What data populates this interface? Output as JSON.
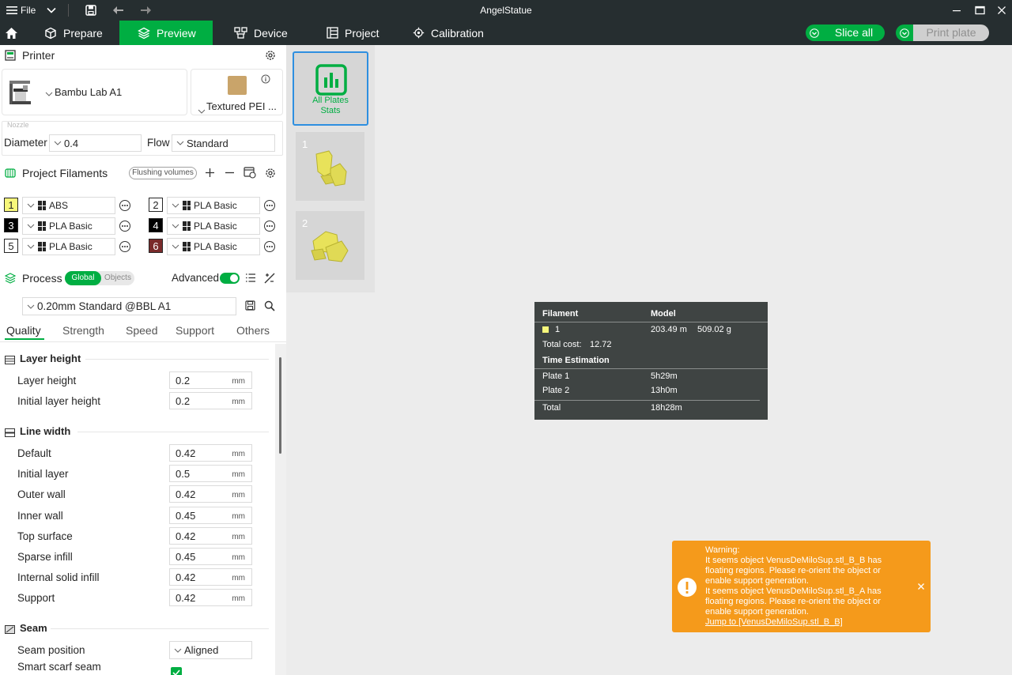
{
  "titlebar": {
    "menu_label": "File",
    "app_title": "AngelStatue"
  },
  "nav": {
    "tabs": [
      {
        "label": "Prepare",
        "icon": "cube-icon"
      },
      {
        "label": "Preview",
        "icon": "layers-icon",
        "active": true
      },
      {
        "label": "Device",
        "icon": "device-icon"
      },
      {
        "label": "Project",
        "icon": "project-icon"
      },
      {
        "label": "Calibration",
        "icon": "calibration-icon"
      }
    ],
    "slice_label": "Slice all",
    "print_label": "Print plate",
    "accent_color": "#00ae42"
  },
  "printer": {
    "section_title": "Printer",
    "printer_name": "Bambu Lab A1",
    "plate_type": "Textured PEI ...",
    "nozzle_label": "Nozzle",
    "diameter_label": "Diameter",
    "diameter_value": "0.4",
    "flow_label": "Flow",
    "flow_value": "Standard"
  },
  "filaments": {
    "section_title": "Project Filaments",
    "flushing_label": "Flushing volumes",
    "items": [
      {
        "num": "1",
        "name": "ABS",
        "color": "#f7f77b",
        "text_color": "#262626"
      },
      {
        "num": "2",
        "name": "PLA Basic",
        "color": "#ffffff",
        "text_color": "#262626"
      },
      {
        "num": "3",
        "name": "PLA Basic",
        "color": "#000000",
        "text_color": "#ffffff"
      },
      {
        "num": "4",
        "name": "PLA Basic",
        "color": "#000000",
        "text_color": "#ffffff"
      },
      {
        "num": "5",
        "name": "PLA Basic",
        "color": "#ffffff",
        "text_color": "#262626"
      },
      {
        "num": "6",
        "name": "PLA Basic",
        "color": "#7a2b2b",
        "text_color": "#ffffff"
      }
    ]
  },
  "process": {
    "section_title": "Process",
    "global_label": "Global",
    "objects_label": "Objects",
    "advanced_label": "Advanced",
    "advanced_on": true,
    "preset": "0.20mm Standard @BBL A1",
    "tabs": [
      "Quality",
      "Strength",
      "Speed",
      "Support",
      "Others"
    ],
    "active_tab": "Quality",
    "groups": {
      "layer_height": {
        "title": "Layer height",
        "rows": [
          {
            "label": "Layer height",
            "value": "0.2",
            "unit": "mm"
          },
          {
            "label": "Initial layer height",
            "value": "0.2",
            "unit": "mm"
          }
        ]
      },
      "line_width": {
        "title": "Line width",
        "rows": [
          {
            "label": "Default",
            "value": "0.42",
            "unit": "mm"
          },
          {
            "label": "Initial layer",
            "value": "0.5",
            "unit": "mm"
          },
          {
            "label": "Outer wall",
            "value": "0.42",
            "unit": "mm"
          },
          {
            "label": "Inner wall",
            "value": "0.45",
            "unit": "mm"
          },
          {
            "label": "Top surface",
            "value": "0.42",
            "unit": "mm"
          },
          {
            "label": "Sparse infill",
            "value": "0.45",
            "unit": "mm"
          },
          {
            "label": "Internal solid infill",
            "value": "0.42",
            "unit": "mm"
          },
          {
            "label": "Support",
            "value": "0.42",
            "unit": "mm"
          }
        ]
      },
      "seam": {
        "title": "Seam",
        "seam_position_label": "Seam position",
        "seam_position_value": "Aligned",
        "smart_scarf_label": "Smart scarf seam",
        "smart_scarf_checked": true
      }
    }
  },
  "plates": {
    "stats_label_line1": "All Plates",
    "stats_label_line2": "Stats",
    "items": [
      {
        "num": "1"
      },
      {
        "num": "2"
      }
    ]
  },
  "stats": {
    "filament_header": "Filament",
    "model_header": "Model",
    "filament_id": "1",
    "filament_color": "#f7f77b",
    "length": "203.49 m",
    "weight": "509.02 g",
    "total_cost_label": "Total cost:",
    "total_cost_value": "12.72",
    "time_header": "Time Estimation",
    "plates": [
      {
        "label": "Plate 1",
        "time": "5h29m"
      },
      {
        "label": "Plate 2",
        "time": "13h0m"
      }
    ],
    "total_label": "Total",
    "total_time": "18h28m"
  },
  "warning": {
    "title": "Warning:",
    "lines": [
      "It seems object VenusDeMiloSup.stl_B_B has",
      "floating regions. Please re-orient the object or",
      "enable support generation.",
      "It seems object VenusDeMiloSup.stl_B_A has",
      "floating regions. Please re-orient the object or",
      "enable support generation."
    ],
    "link": "Jump to [VenusDeMiloSup.stl_B_B]",
    "color": "#f59a1b"
  }
}
